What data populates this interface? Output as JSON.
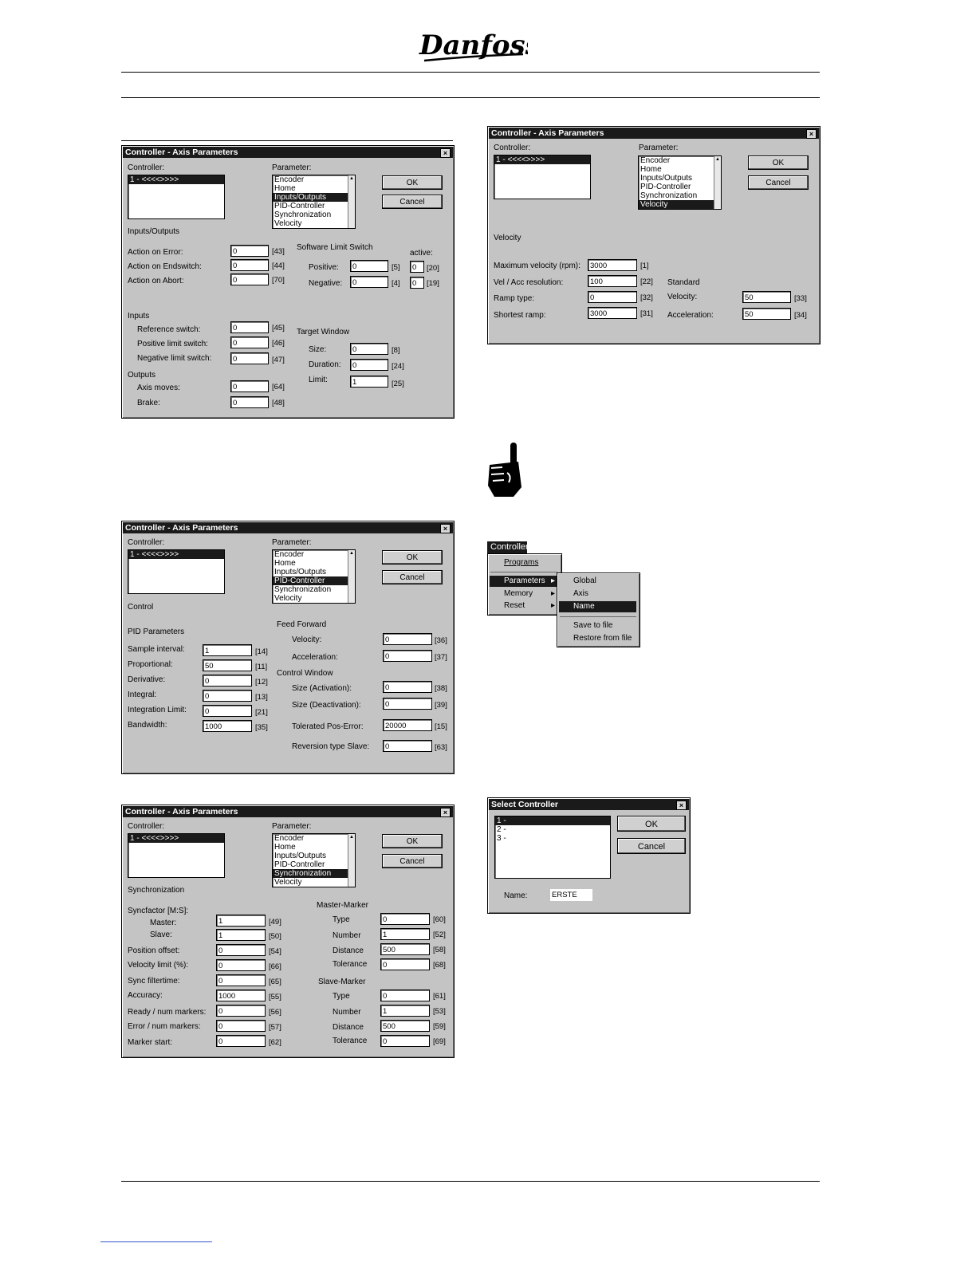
{
  "brand": {
    "logo_text": "Danfoss"
  },
  "dlg1": {
    "title": "Controller - Axis Parameters",
    "controller_label": "Controller:",
    "controller_item": "1 - <<<<>>>>",
    "parameter_label": "Parameter:",
    "params": [
      "Encoder",
      "Home",
      "Inputs/Outputs",
      "PID-Controller",
      "Synchronization",
      "Velocity"
    ],
    "selected": "Inputs/Outputs",
    "ok": "OK",
    "cancel": "Cancel",
    "section": "Inputs/Outputs",
    "action_error": "Action on Error:",
    "action_error_val": "0",
    "action_error_tag": "[43]",
    "action_end": "Action on Endswitch:",
    "action_end_val": "0",
    "action_end_tag": "[44]",
    "action_abort": "Action on Abort:",
    "action_abort_val": "0",
    "action_abort_tag": "[70]",
    "sls": "Software Limit Switch",
    "active": "active:",
    "pos": "Positive:",
    "pos_val": "0",
    "pos_tag": "[5]",
    "pos_act": "0",
    "pos_act_tag": "[20]",
    "neg": "Negative:",
    "neg_val": "0",
    "neg_tag": "[4]",
    "neg_act": "0",
    "neg_act_tag": "[19]",
    "inputs": "Inputs",
    "ref": "Reference switch:",
    "ref_val": "0",
    "ref_tag": "[45]",
    "plim": "Positive limit switch:",
    "plim_val": "0",
    "plim_tag": "[46]",
    "nlim": "Negative limit switch:",
    "nlim_val": "0",
    "nlim_tag": "[47]",
    "tw": "Target Window",
    "size": "Size:",
    "size_val": "0",
    "size_tag": "[8]",
    "dur": "Duration:",
    "dur_val": "0",
    "dur_tag": "[24]",
    "lim": "Limit:",
    "lim_val": "1",
    "lim_tag": "[25]",
    "outputs": "Outputs",
    "axis": "Axis moves:",
    "axis_val": "0",
    "axis_tag": "[64]",
    "brake": "Brake:",
    "brake_val": "0",
    "brake_tag": "[48]"
  },
  "dlg2": {
    "title": "Controller - Axis Parameters",
    "controller_label": "Controller:",
    "controller_item": "1 - <<<<>>>>",
    "parameter_label": "Parameter:",
    "params": [
      "Encoder",
      "Home",
      "Inputs/Outputs",
      "PID-Controller",
      "Synchronization",
      "Velocity"
    ],
    "selected": "Velocity",
    "ok": "OK",
    "cancel": "Cancel",
    "section": "Velocity",
    "maxvel": "Maximum velocity (rpm):",
    "maxvel_val": "3000",
    "maxvel_tag": "[1]",
    "res": "Vel / Acc resolution:",
    "res_val": "100",
    "res_tag": "[22]",
    "ramp": "Ramp type:",
    "ramp_val": "0",
    "ramp_tag": "[32]",
    "short": "Shortest ramp:",
    "short_val": "3000",
    "short_tag": "[31]",
    "standard": "Standard",
    "vel": "Velocity:",
    "vel_val": "50",
    "vel_tag": "[33]",
    "acc": "Acceleration:",
    "acc_val": "50",
    "acc_tag": "[34]"
  },
  "dlg3": {
    "title": "Controller - Axis Parameters",
    "controller_label": "Controller:",
    "controller_item": "1 - <<<<>>>>",
    "parameter_label": "Parameter:",
    "params": [
      "Encoder",
      "Home",
      "Inputs/Outputs",
      "PID-Controller",
      "Synchronization",
      "Velocity"
    ],
    "selected": "PID-Controller",
    "ok": "OK",
    "cancel": "Cancel",
    "section": "Control",
    "pid": "PID Parameters",
    "sample": "Sample interval:",
    "sample_val": "1",
    "sample_tag": "[14]",
    "prop": "Proportional:",
    "prop_val": "50",
    "prop_tag": "[11]",
    "deriv": "Derivative:",
    "deriv_val": "0",
    "deriv_tag": "[12]",
    "integ": "Integral:",
    "integ_val": "0",
    "integ_tag": "[13]",
    "intlim": "Integration Limit:",
    "intlim_val": "0",
    "intlim_tag": "[21]",
    "bw": "Bandwidth:",
    "bw_val": "1000",
    "bw_tag": "[35]",
    "ff": "Feed Forward",
    "ffvel": "Velocity:",
    "ffvel_val": "0",
    "ffvel_tag": "[36]",
    "ffacc": "Acceleration:",
    "ffacc_val": "0",
    "ffacc_tag": "[37]",
    "cw": "Control Window",
    "sact": "Size (Activation):",
    "sact_val": "0",
    "sact_tag": "[38]",
    "sdeact": "Size (Deactivation):",
    "sdeact_val": "0",
    "sdeact_tag": "[39]",
    "tol": "Tolerated Pos-Error:",
    "tol_val": "20000",
    "tol_tag": "[15]",
    "rev": "Reversion type Slave:",
    "rev_val": "0",
    "rev_tag": "[63]"
  },
  "dlg4": {
    "title": "Controller - Axis Parameters",
    "controller_label": "Controller:",
    "controller_item": "1 - <<<<>>>>",
    "parameter_label": "Parameter:",
    "params": [
      "Encoder",
      "Home",
      "Inputs/Outputs",
      "PID-Controller",
      "Synchronization",
      "Velocity"
    ],
    "selected": "Synchronization",
    "ok": "OK",
    "cancel": "Cancel",
    "section": "Synchronization",
    "sf": "Syncfactor [M:S]:",
    "master": "Master:",
    "master_val": "1",
    "master_tag": "[49]",
    "slave": "Slave:",
    "slave_val": "1",
    "slave_tag": "[50]",
    "posoff": "Position offset:",
    "posoff_val": "0",
    "posoff_tag": "[54]",
    "vlim": "Velocity limit (%):",
    "vlim_val": "0",
    "vlim_tag": "[66]",
    "sft": "Sync filtertime:",
    "sft_val": "0",
    "sft_tag": "[65]",
    "accu": "Accuracy:",
    "accu_val": "1000",
    "accu_tag": "[55]",
    "ready": "Ready / num markers:",
    "ready_val": "0",
    "ready_tag": "[56]",
    "err": "Error / num markers:",
    "err_val": "0",
    "err_tag": "[57]",
    "mstart": "Marker start:",
    "mstart_val": "0",
    "mstart_tag": "[62]",
    "mm": "Master-Marker",
    "mtype": "Type",
    "mtype_val": "0",
    "mtype_tag": "[60]",
    "mnum": "Number",
    "mnum_val": "1",
    "mnum_tag": "[52]",
    "mdist": "Distance",
    "mdist_val": "500",
    "mdist_tag": "[58]",
    "mtol": "Tolerance",
    "mtol_val": "0",
    "mtol_tag": "[68]",
    "sm": "Slave-Marker",
    "stype": "Type",
    "stype_val": "0",
    "stype_tag": "[61]",
    "snum": "Number",
    "snum_val": "1",
    "snum_tag": "[53]",
    "sdist": "Distance",
    "sdist_val": "500",
    "sdist_tag": "[59]",
    "stol": "Tolerance",
    "stol_val": "0",
    "stol_tag": "[69]"
  },
  "menu": {
    "title": "Controller",
    "programs": "Programs",
    "parameters": "Parameters",
    "memory": "Memory",
    "reset": "Reset",
    "sub": [
      "Global",
      "Axis",
      "Name",
      "Save to file",
      "Restore from file"
    ],
    "sub_selected": "Name"
  },
  "select": {
    "title": "Select Controller",
    "items": [
      "1 -",
      "2 -",
      "3 -"
    ],
    "ok": "OK",
    "cancel": "Cancel",
    "name_label": "Name:",
    "name_val": "ERSTE"
  }
}
